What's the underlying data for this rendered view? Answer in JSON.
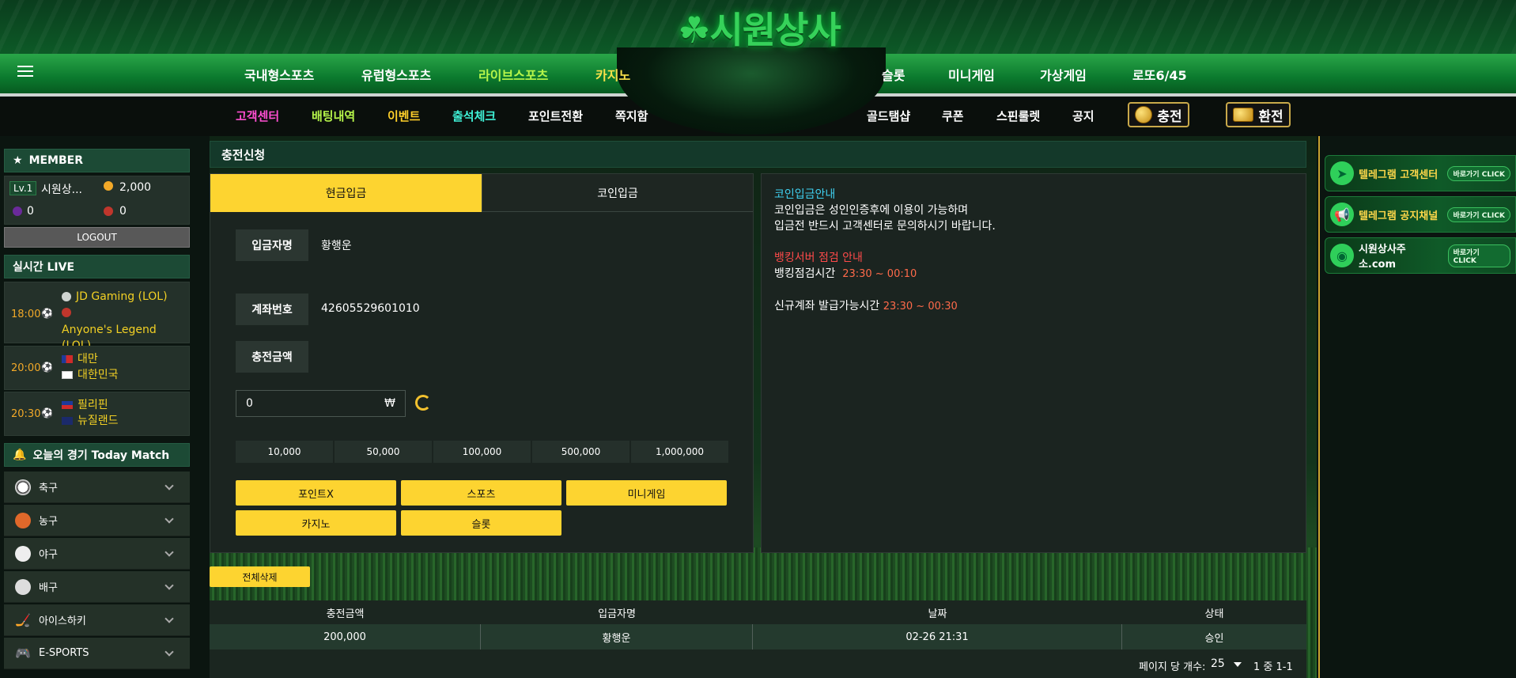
{
  "site": {
    "logo_text": "☘시원상사"
  },
  "nav_primary": [
    {
      "label": "국내형스포츠",
      "color": "#ffffff"
    },
    {
      "label": "유럽형스포츠",
      "color": "#ffffff"
    },
    {
      "label": "라이브스포츠",
      "color": "#b6f54a"
    },
    {
      "label": "카지노",
      "color": "#f9e04a"
    },
    {
      "label": "슬롯",
      "color": "#ffffff"
    },
    {
      "label": "미니게임",
      "color": "#ffffff"
    },
    {
      "label": "가상게임",
      "color": "#ffffff"
    },
    {
      "label": "로또6/45",
      "color": "#ffffff"
    }
  ],
  "nav_secondary": [
    {
      "label": "고객센터",
      "color": "#ff4fd2"
    },
    {
      "label": "배팅내역",
      "color": "#b6f54a"
    },
    {
      "label": "이벤트",
      "color": "#ffd02a"
    },
    {
      "label": "출석체크",
      "color": "#3ff0d6"
    },
    {
      "label": "포인트전환",
      "color": "#ffffff"
    },
    {
      "label": "쪽지함",
      "color": "#ffffff"
    },
    {
      "label": "골드탬샵",
      "color": "#ffffff"
    },
    {
      "label": "쿠폰",
      "color": "#ffffff"
    },
    {
      "label": "스핀룰렛",
      "color": "#ffffff"
    },
    {
      "label": "공지",
      "color": "#ffffff"
    }
  ],
  "header_buttons": {
    "charge": "충전",
    "exchange": "환전"
  },
  "member": {
    "title": "MEMBER",
    "level": "Lv.1",
    "name": "시원상...",
    "money": "2,000",
    "point": "0",
    "coupon": "0",
    "logout": "LOGOUT"
  },
  "live": {
    "title": "실시간 LIVE",
    "matches": [
      {
        "time": "18:00",
        "team1": "JD Gaming (LOL)",
        "team2": "Anyone's Legend (LOL)"
      },
      {
        "time": "20:00",
        "team1": "대만",
        "team2": "대한민국"
      },
      {
        "time": "20:30",
        "team1": "필리핀",
        "team2": "뉴질랜드"
      }
    ]
  },
  "today": {
    "title": "오늘의 경기 Today Match",
    "sports": [
      "축구",
      "농구",
      "야구",
      "배구",
      "아이스하키",
      "E-SPORTS"
    ]
  },
  "main": {
    "title": "충전신청",
    "tabs": [
      "현금입금",
      "코인입금"
    ],
    "depositor_label": "입금자명",
    "depositor_value": "황행운",
    "account_label": "계좌번호",
    "account_value": "42605529601010",
    "amount_label": "충전금액",
    "amount_value": "0",
    "currency": "₩",
    "quick_amounts": [
      "10,000",
      "50,000",
      "100,000",
      "500,000",
      "1,000,000"
    ],
    "bonus_buttons": [
      "포인트X",
      "스포츠",
      "미니게임",
      "카지노",
      "슬롯"
    ]
  },
  "info": {
    "coin_title": "코인입금안내",
    "coin_line1": "코인입금은 성인인증후에 이용이 가능하며",
    "coin_line2": "입금전 반드시 고객센터로 문의하시기 바랍니다.",
    "bank_title": "뱅킹서버 점검 안내",
    "bank_label": "뱅킹점검시간",
    "bank_time": "23:30 ~ 00:10",
    "new_label": "신규계좌 발급가능시간",
    "new_time": "23:30 ~ 00:30"
  },
  "history": {
    "delete_all": "전체삭제",
    "headers": [
      "충전금액",
      "입금자명",
      "날짜",
      "상태"
    ],
    "rows": [
      {
        "amount": "200,000",
        "name": "황행운",
        "date": "02-26 21:31",
        "status": "승인"
      }
    ],
    "per_page_label": "페이지 당 개수:",
    "per_page": "25",
    "range": "1 중 1-1"
  },
  "banners": [
    {
      "text": "텔레그램 고객센터",
      "tag": "바로가기 CLICK",
      "icon": "telegram-icon"
    },
    {
      "text": "텔레그램 공지채널",
      "tag": "바로가기 CLICK",
      "icon": "megaphone-icon"
    },
    {
      "text": "시원상사주소.com",
      "tag": "바로가기 CLICK",
      "icon": "globe-icon"
    }
  ]
}
